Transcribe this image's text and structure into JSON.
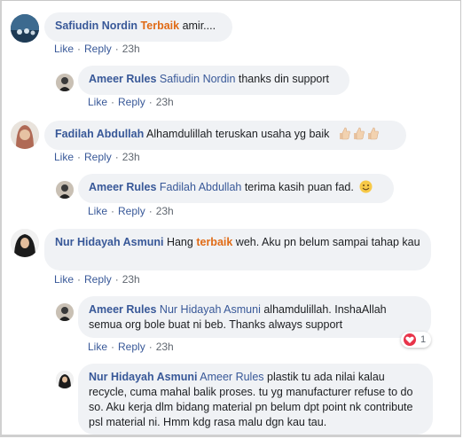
{
  "comments": [
    {
      "author": "Safiudin Nordin",
      "parts": [
        "Terbaik",
        " amir...."
      ],
      "actions": {
        "like": "Like",
        "reply": "Reply",
        "time": "23h"
      }
    },
    {
      "author": "Ameer Rules",
      "tag": "Safiudin Nordin",
      "text": " thanks din support",
      "actions": {
        "like": "Like",
        "reply": "Reply",
        "time": "23h"
      }
    },
    {
      "author": "Fadilah Abdullah",
      "text": " Alhamdulillah teruskan usaha yg baik",
      "actions": {
        "like": "Like",
        "reply": "Reply",
        "time": "23h"
      }
    },
    {
      "author": "Ameer Rules",
      "tag": "Fadilah Abdullah",
      "text": " terima kasih puan fad.",
      "actions": {
        "like": "Like",
        "reply": "Reply",
        "time": "23h"
      }
    },
    {
      "author": "Nur Hidayah Asmuni",
      "text_before": " Hang ",
      "keyword": "terbaik",
      "text_after": " weh. Aku pn belum sampai tahap kau",
      "actions": {
        "like": "Like",
        "reply": "Reply",
        "time": "23h"
      }
    },
    {
      "author": "Ameer Rules",
      "tag": "Nur Hidayah Asmuni",
      "text": " alhamdulillah. InshaAllah semua org bole buat ni beb. Thanks always support",
      "reaction_count": "1",
      "actions": {
        "like": "Like",
        "reply": "Reply",
        "time": "23h"
      }
    },
    {
      "author": "Nur Hidayah Asmuni",
      "tag": "Ameer Rules",
      "text": " plastik tu ada nilai kalau recycle, cuma mahal balik proses. tu yg manufacturer refuse to do so. Aku kerja dlm bidang material pn belum dpt point nk contribute psl material ni. Hmm kdg rasa malu dgn kau tau."
    }
  ],
  "colors": {
    "name": "#385898",
    "keyword": "#e06b16",
    "bubble": "#f0f2f5",
    "heart": "#e8344a"
  }
}
